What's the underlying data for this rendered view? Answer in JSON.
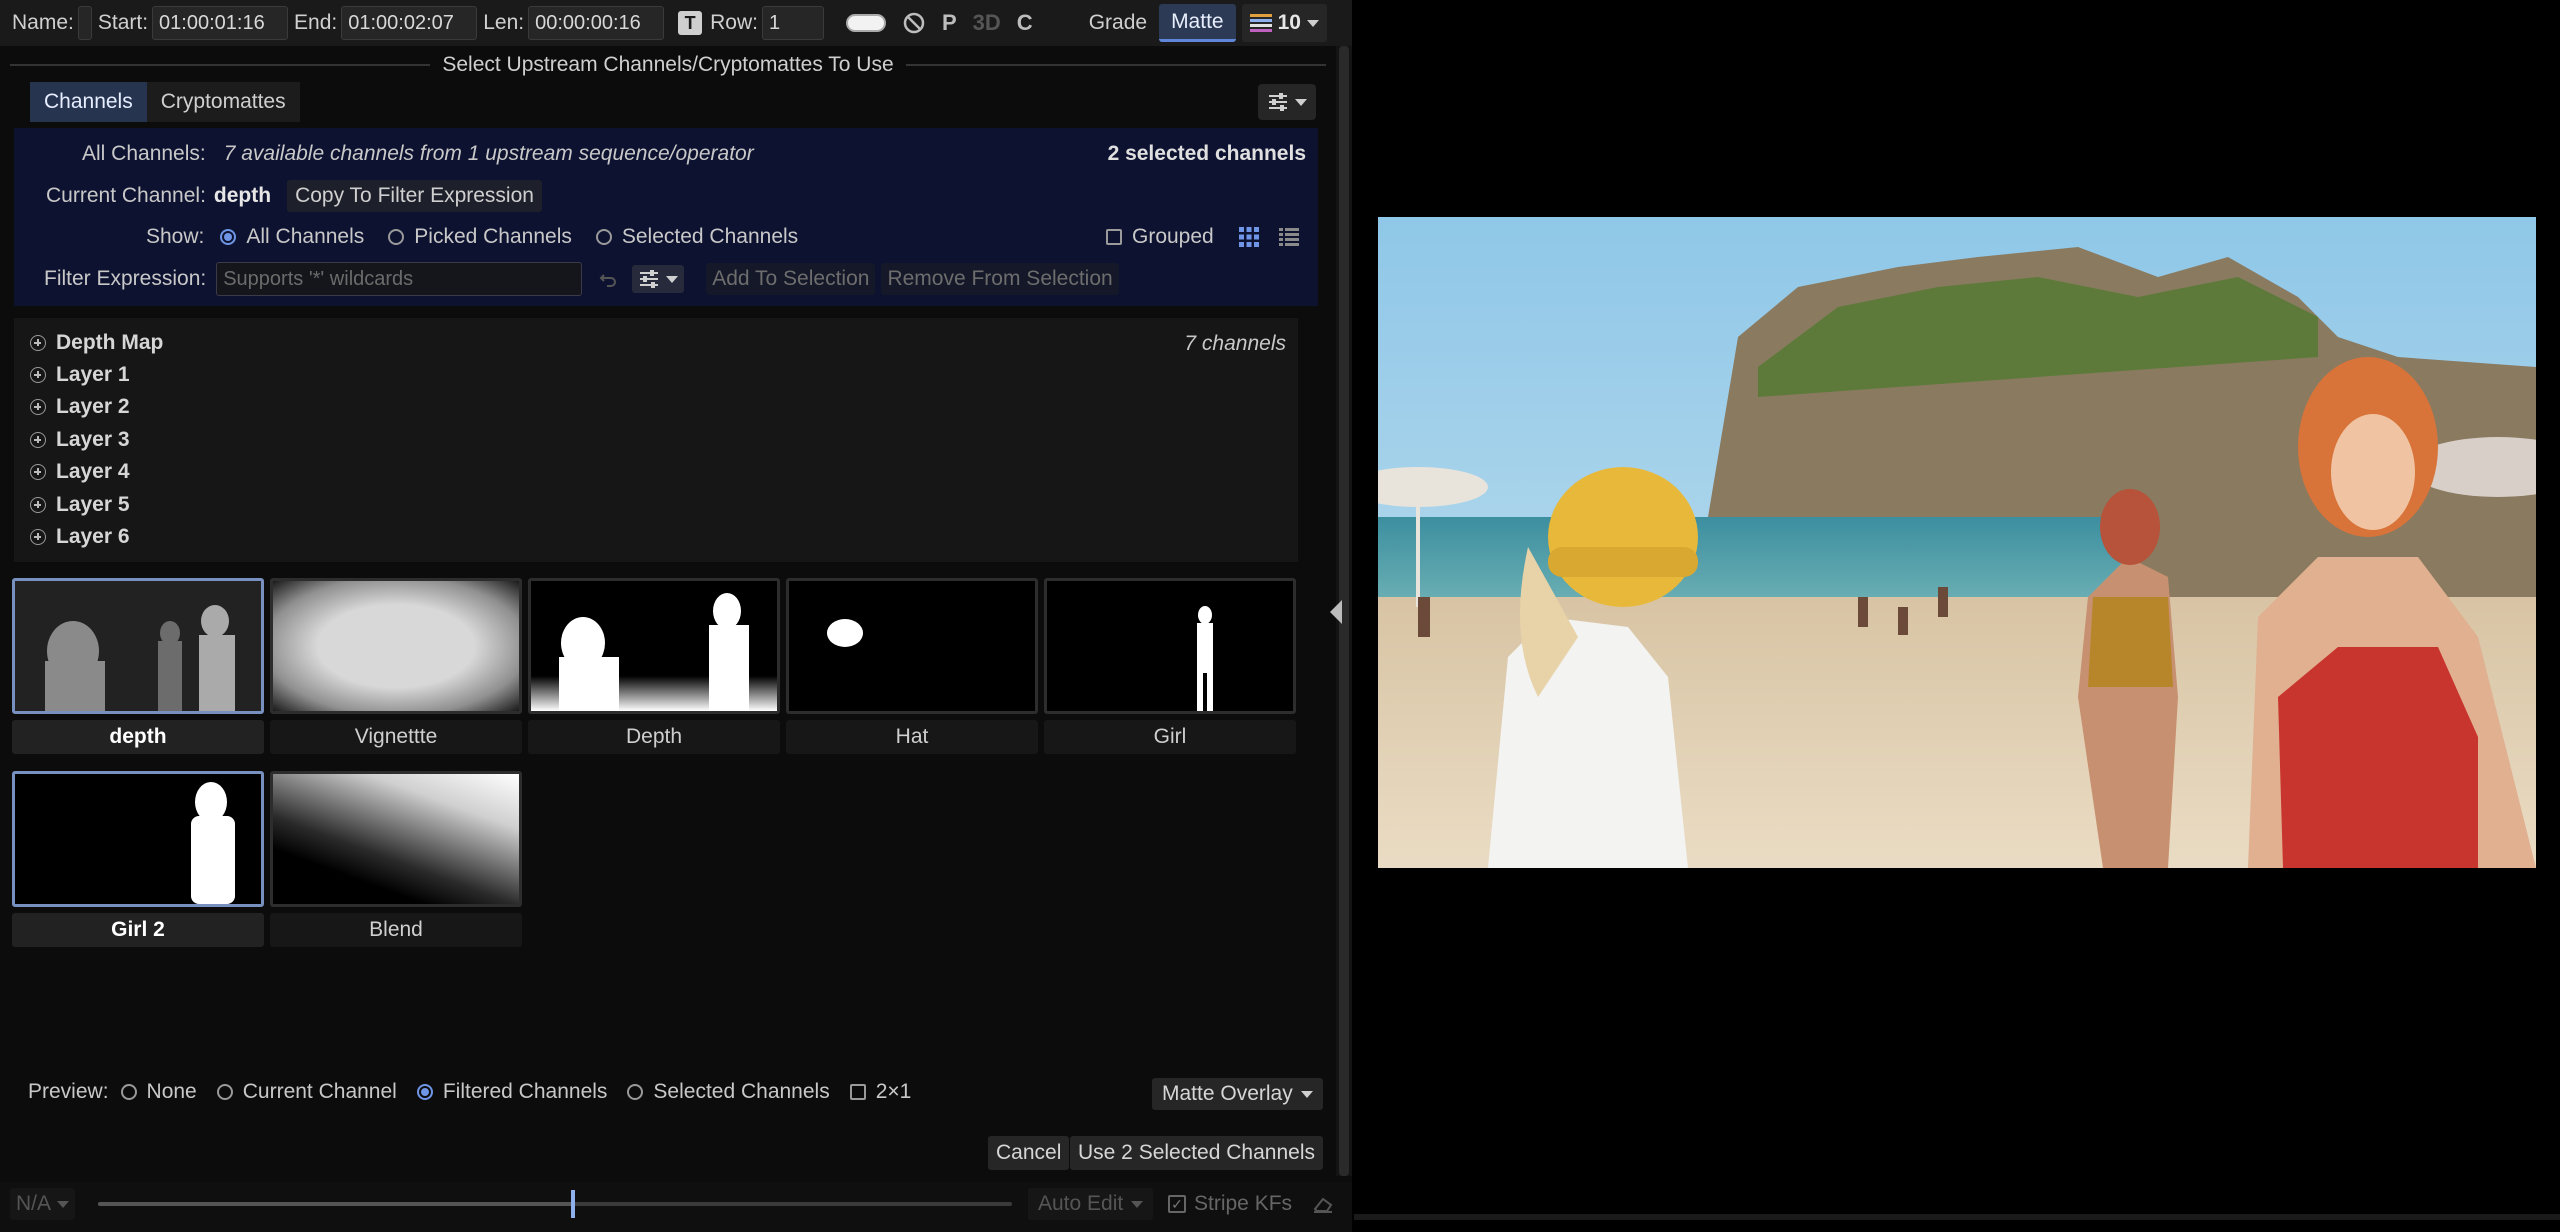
{
  "topbar": {
    "name_label": "Name:",
    "start_label": "Start:",
    "start_value": "01:00:01:16",
    "end_label": "End:",
    "end_value": "01:00:02:07",
    "len_label": "Len:",
    "len_value": "00:00:00:16",
    "row_label": "Row:",
    "row_value": "1",
    "p_label": "P",
    "three_d_label": "3D",
    "c_label": "C",
    "grade_label": "Grade",
    "matte_label": "Matte",
    "layers_count": "10"
  },
  "dialog": {
    "title": "Select Upstream Channels/Cryptomattes To Use",
    "tabs": [
      {
        "label": "Channels",
        "active": true
      },
      {
        "label": "Cryptomattes",
        "active": false
      }
    ],
    "all_channels_label": "All Channels:",
    "all_channels_desc": "7 available channels from 1 upstream sequence/operator",
    "selected_count": "2 selected channels",
    "current_channel_label": "Current Channel:",
    "current_channel_value": "depth",
    "copy_button": "Copy To Filter Expression",
    "show_label": "Show:",
    "show_options": [
      "All Channels",
      "Picked Channels",
      "Selected Channels"
    ],
    "show_selected": "All Channels",
    "grouped_label": "Grouped",
    "filter_label": "Filter Expression:",
    "filter_placeholder": "Supports '*' wildcards",
    "add_to_selection": "Add To Selection",
    "remove_from_selection": "Remove From Selection"
  },
  "tree": {
    "count": "7 channels",
    "items": [
      "Depth Map",
      "Layer 1",
      "Layer 2",
      "Layer 3",
      "Layer 4",
      "Layer 5",
      "Layer 6"
    ]
  },
  "thumbnails": [
    {
      "label": "depth",
      "selected": true,
      "kind": "depth"
    },
    {
      "label": "Vignettte",
      "selected": false,
      "kind": "vignette"
    },
    {
      "label": "Depth",
      "selected": false,
      "kind": "depth2"
    },
    {
      "label": "Hat",
      "selected": false,
      "kind": "hat"
    },
    {
      "label": "Girl",
      "selected": false,
      "kind": "girl"
    },
    {
      "label": "Girl 2",
      "selected": true,
      "kind": "girl2"
    },
    {
      "label": "Blend",
      "selected": false,
      "kind": "blend"
    }
  ],
  "preview": {
    "label": "Preview:",
    "options": [
      "None",
      "Current Channel",
      "Filtered Channels",
      "Selected Channels"
    ],
    "selected": "Filtered Channels",
    "two_by_one": "2×1",
    "overlay_mode": "Matte Overlay"
  },
  "actions": {
    "cancel": "Cancel",
    "use_selected": "Use 2 Selected Channels"
  },
  "bottombar": {
    "na_label": "N/A",
    "auto_edit": "Auto Edit",
    "stripe_kfs": "Stripe KFs",
    "playhead_position": 0.52
  },
  "colors": {
    "accent": "#5f86d8",
    "panel_blue": "#0d1230",
    "active_tab": "#27344f"
  }
}
